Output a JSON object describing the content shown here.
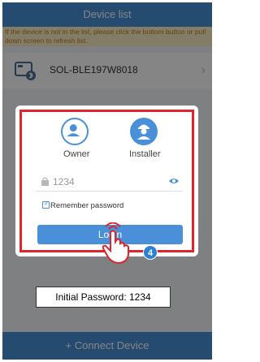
{
  "header": {
    "title": "Device list"
  },
  "notice": {
    "text": "If the device is not in the list, please click the bottom button or pull down screen to refresh list."
  },
  "device_list": [
    {
      "name": "SOL-BLE197W8018",
      "icon": "inverter-bluetooth-icon"
    }
  ],
  "bottom_bar": {
    "label": "+ Connect Device"
  },
  "login_dialog": {
    "roles": [
      {
        "label": "Owner",
        "icon": "person-icon",
        "selected": false
      },
      {
        "label": "Installer",
        "icon": "installer-icon",
        "selected": true
      }
    ],
    "password": {
      "value": "1234"
    },
    "remember_password": {
      "label": "Remember password",
      "checked": true
    },
    "login_button": {
      "label": "Login"
    }
  },
  "annotations": {
    "step_number": "4",
    "callout": "Initial Password: 1234"
  },
  "colors": {
    "primary": "#4a90d9",
    "highlight": "#e0242c",
    "notice_bg": "#fbf0c8"
  }
}
